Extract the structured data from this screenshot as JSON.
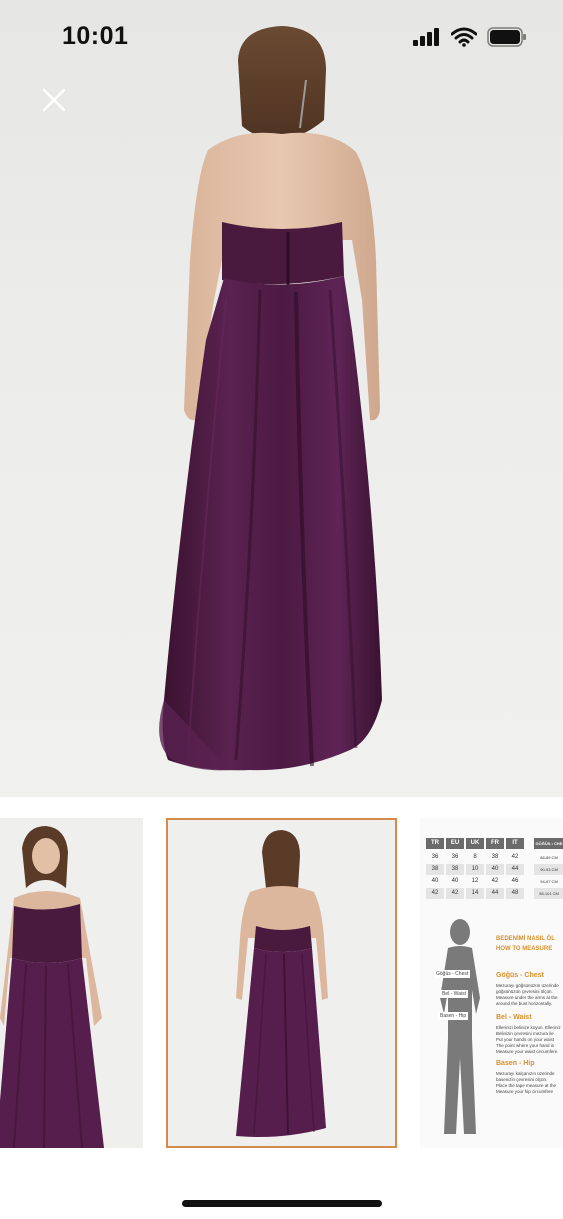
{
  "status": {
    "time": "10:01",
    "icons": [
      "cellular-signal-icon",
      "wifi-icon",
      "battery-icon"
    ]
  },
  "viewer": {
    "close_icon": "close-icon",
    "main_image": "purple-strapless-gown-back-view"
  },
  "thumbnails": [
    {
      "name": "front-view",
      "selected": false
    },
    {
      "name": "back-view",
      "selected": true
    },
    {
      "name": "size-chart",
      "selected": false
    }
  ],
  "size_chart": {
    "headers": [
      "TR",
      "EU",
      "UK",
      "FR",
      "IT"
    ],
    "chest_header": "GÖĞÜS • CHE",
    "rows": [
      [
        "36",
        "36",
        "8",
        "38",
        "42",
        "86-89 CM"
      ],
      [
        "38",
        "38",
        "10",
        "40",
        "44",
        "90-93 CM"
      ],
      [
        "40",
        "40",
        "12",
        "42",
        "46",
        "94-97 CM"
      ],
      [
        "42",
        "42",
        "14",
        "44",
        "48",
        "98-101 CM"
      ]
    ],
    "title_tr": "BEDENİMİ NASIL ÖL",
    "title_en": "HOW TO MEASURE",
    "figure_labels": [
      "Göğüs - Chest",
      "Bel - Waist",
      "Basen - Hip"
    ],
    "sections": [
      {
        "heading": "Göğüs - Chest",
        "lines": [
          "Mezurayı göğsünüzün üzerinde",
          "göğsünüzün çevresini ölçün.",
          "Measure under the arms at the",
          "around the bust horizontally."
        ]
      },
      {
        "heading": "Bel - Waist",
        "lines": [
          "Ellerinizi belinize koyun. Elleriniz",
          "Belinizin çevresini mezura ile",
          "Put your hands on your waist",
          "The point where your hand is",
          "Measure your waist circumfere"
        ]
      },
      {
        "heading": "Basen - Hip",
        "lines": [
          "Mezurayı kalçanızın üzerinde",
          "basenizin çevresini ölçün.",
          "Place the tape measure at the",
          "Measure your hip circumfere"
        ]
      }
    ]
  },
  "colors": {
    "dress": "#4a1a3e",
    "selected_outline": "#d48a4a",
    "accent_orange": "#d8902c"
  }
}
